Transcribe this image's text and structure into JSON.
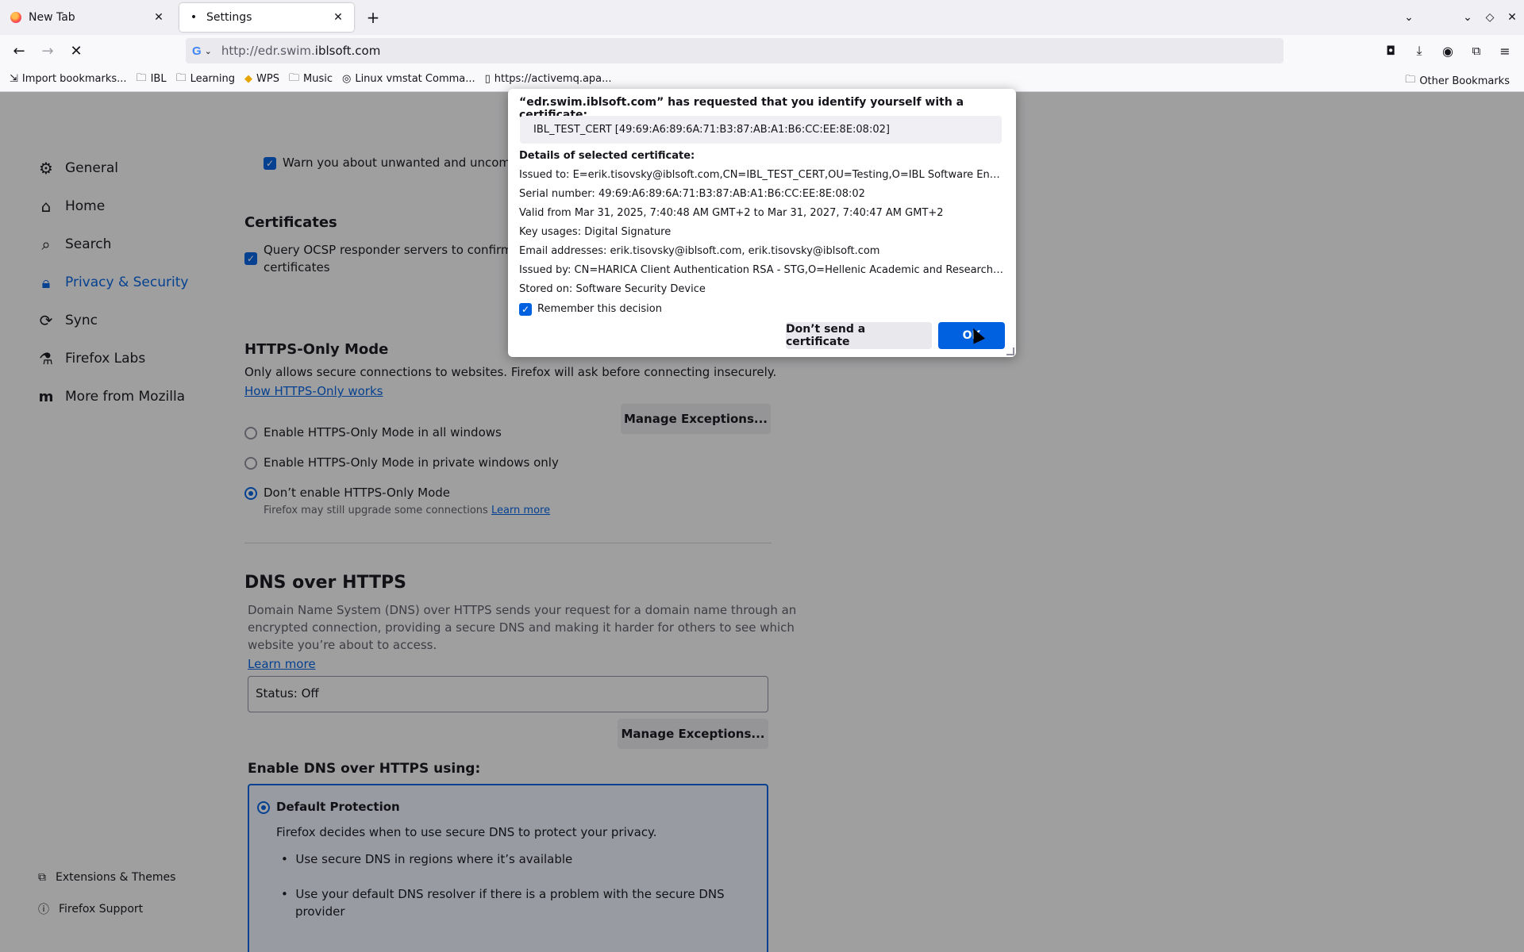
{
  "tabs": [
    {
      "label": "New Tab",
      "icon": "firefox-icon"
    },
    {
      "label": "Settings",
      "icon": "settings-dot-icon"
    }
  ],
  "nav": {
    "url_prefix": "http://edr.swim.",
    "url_domain": "iblsoft.com",
    "search_engine": "G"
  },
  "bookmarks": [
    {
      "label": "Import bookmarks...",
      "icon": "import-icon"
    },
    {
      "label": "IBL",
      "icon": "folder-icon"
    },
    {
      "label": "Learning",
      "icon": "folder-icon"
    },
    {
      "label": "WPS",
      "icon": "wps-icon"
    },
    {
      "label": "Music",
      "icon": "folder-icon"
    },
    {
      "label": "Linux vmstat Comma...",
      "icon": "site-icon"
    },
    {
      "label": "https://activemq.apa...",
      "icon": "book-icon"
    }
  ],
  "bookmarks_other": "Other Bookmarks",
  "sidebar": {
    "items": [
      {
        "label": "General",
        "icon": "gear-icon"
      },
      {
        "label": "Home",
        "icon": "home-icon"
      },
      {
        "label": "Search",
        "icon": "search-icon"
      },
      {
        "label": "Privacy & Security",
        "icon": "lock-icon",
        "active": true
      },
      {
        "label": "Sync",
        "icon": "sync-icon"
      },
      {
        "label": "Firefox Labs",
        "icon": "labs-icon"
      },
      {
        "label": "More from Mozilla",
        "icon": "mozilla-icon"
      }
    ],
    "footer": [
      {
        "label": "Extensions & Themes",
        "icon": "puzzle-icon"
      },
      {
        "label": "Firefox Support",
        "icon": "help-icon"
      }
    ]
  },
  "content": {
    "warn_unwanted": "Warn you about unwanted and uncomm",
    "certificates_title": "Certificates",
    "ocsp_label": "Query OCSP responder servers to confirm th",
    "ocsp_label2": "certificates",
    "https_title": "HTTPS-Only Mode",
    "https_desc": "Only allows secure connections to websites. Firefox will ask before connecting insecurely.",
    "https_link": "How HTTPS-Only works",
    "manage_exceptions": "Manage Exceptions...",
    "https_opt_all": "Enable HTTPS-Only Mode in all windows",
    "https_opt_private": "Enable HTTPS-Only Mode in private windows only",
    "https_opt_off": "Don’t enable HTTPS-Only Mode",
    "https_off_note": "Firefox may still upgrade some connections",
    "learn_more": "Learn more",
    "dns_title": "DNS over HTTPS",
    "dns_desc1": "Domain Name System (DNS) over HTTPS sends your request for a domain name through an",
    "dns_desc2": "encrypted connection, providing a secure DNS and making it harder for others to see which",
    "dns_desc3": "website you’re about to access.",
    "dns_learn_more": "Learn more",
    "dns_status": "Status: Off",
    "dns_manage_exceptions": "Manage Exceptions...",
    "dns_using_title": "Enable DNS over HTTPS using:",
    "default_protection": "Default Protection",
    "default_desc": "Firefox decides when to use secure DNS to protect your privacy.",
    "bullet1": "Use secure DNS in regions where it’s available",
    "bullet2a": "Use your default DNS resolver if there is a problem with the secure DNS",
    "bullet2b": "provider"
  },
  "dialog": {
    "title": "“edr.swim.iblsoft.com” has requested that you identify yourself with a certificate:",
    "selected_cert": "IBL_TEST_CERT [49:69:A6:89:6A:71:B3:87:AB:A1:B6:CC:EE:8E:08:02]",
    "details_title": "Details of selected certificate:",
    "lines": [
      "Issued to: E=erik.tisovsky@iblsoft.com,CN=IBL_TEST_CERT,OU=Testing,O=IBL Software Engineeri...",
      "Serial number: 49:69:A6:89:6A:71:B3:87:AB:A1:B6:CC:EE:8E:08:02",
      "Valid from Mar 31, 2025, 7:40:48 AM GMT+2 to Mar 31, 2027, 7:40:47 AM GMT+2",
      "Key usages: Digital Signature",
      "Email addresses: erik.tisovsky@iblsoft.com, erik.tisovsky@iblsoft.com",
      "Issued by: CN=HARICA Client Authentication RSA - STG,O=Hellenic Academic and Research Instit...",
      "Stored on: Software Security Device"
    ],
    "remember_label": "Remember this decision",
    "remember_checked": true,
    "dont_send_label": "Don’t send a certificate",
    "ok_label": "OK"
  },
  "colors": {
    "accent": "#0061e0",
    "overlay": "rgba(12,12,13,0.38)"
  }
}
